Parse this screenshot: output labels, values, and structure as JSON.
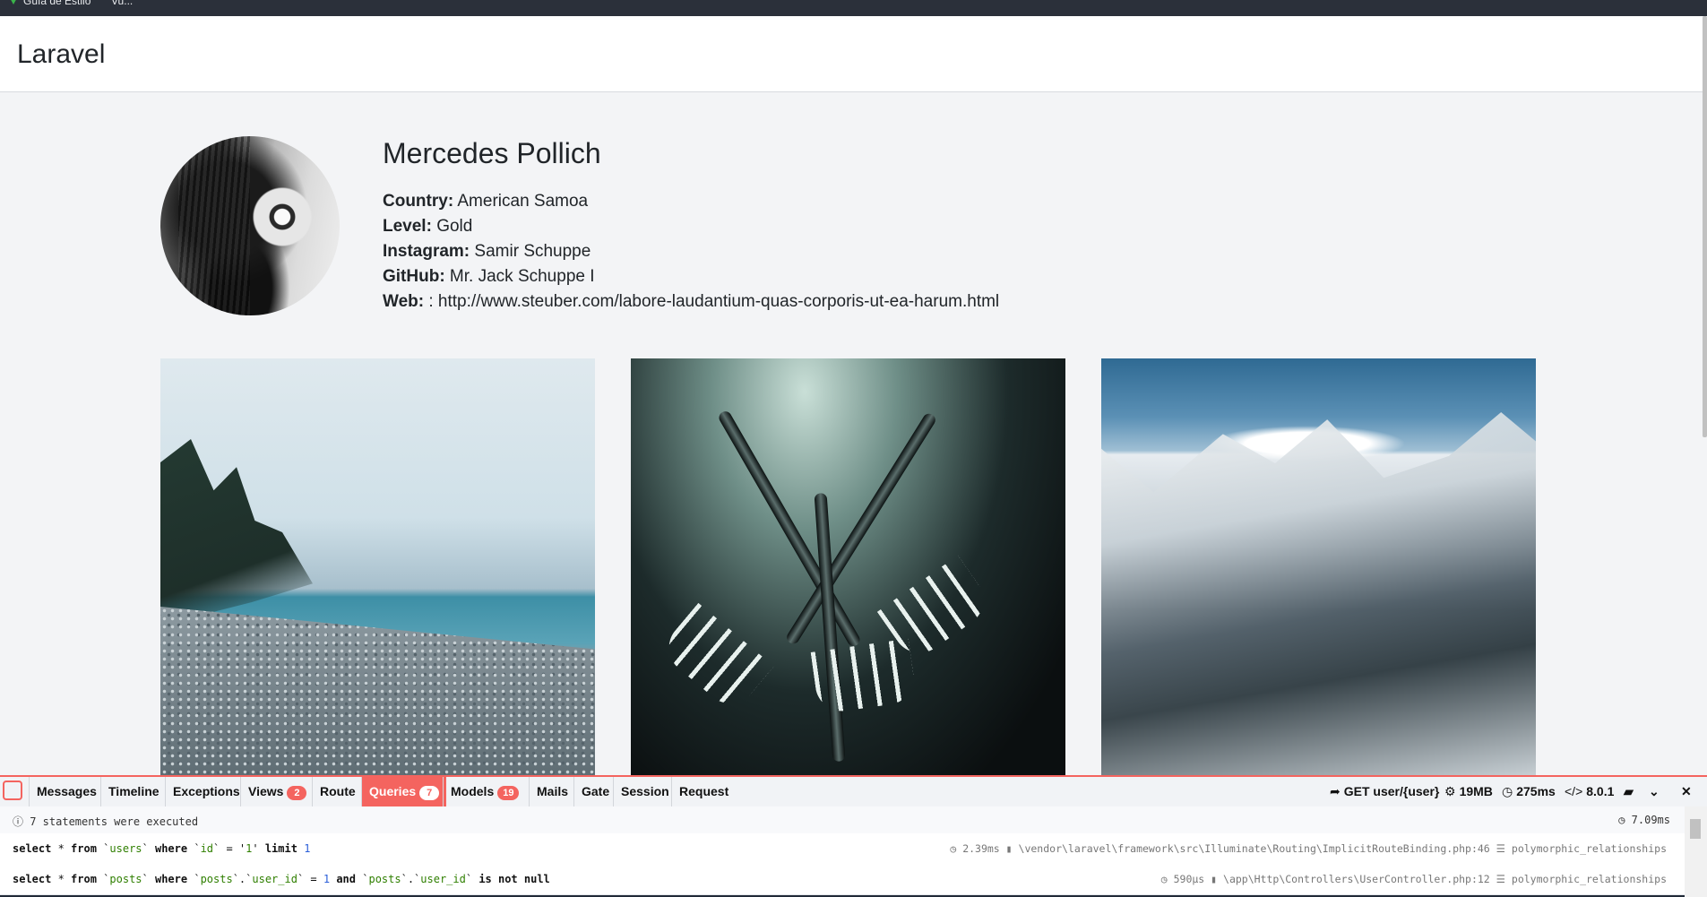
{
  "bookmarks": [
    {
      "label": "Guía de Estilo"
    },
    {
      "label": "Vu..."
    }
  ],
  "navbar": {
    "brand": "Laravel"
  },
  "profile": {
    "name": "Mercedes Pollich",
    "details": [
      {
        "label": "Country:",
        "value": " American Samoa"
      },
      {
        "label": "Level:",
        "value": " Gold"
      },
      {
        "label": "Instagram:",
        "value": " Samir Schuppe"
      },
      {
        "label": "GitHub:",
        "value": " Mr. Jack Schuppe I"
      },
      {
        "label": "Web:",
        "value": " : http://www.steuber.com/labore-laudantium-quas-corporis-ut-ea-harum.html"
      }
    ]
  },
  "photos": [
    "beach",
    "forks",
    "mountains"
  ],
  "debugbar": {
    "tabs": [
      {
        "label": "Messages"
      },
      {
        "label": "Timeline"
      },
      {
        "label": "Exceptions"
      },
      {
        "label": "Views",
        "badge": "2"
      },
      {
        "label": "Route"
      },
      {
        "label": "Queries",
        "badge": "7",
        "active": true
      },
      {
        "label": "Models",
        "badge": "19"
      },
      {
        "label": "Mails"
      },
      {
        "label": "Gate"
      },
      {
        "label": "Session"
      },
      {
        "label": "Request"
      }
    ],
    "right": {
      "request": "GET user/{user}",
      "memory": "19MB",
      "duration": "275ms",
      "php": "8.0.1"
    },
    "status": {
      "text": "7 statements were executed",
      "time": "7.09ms"
    },
    "queries": [
      {
        "sql": "select * from `users` where `id` = '1' limit 1",
        "duration": "2.39ms",
        "source": "\\vendor\\laravel\\framework\\src\\Illuminate\\Routing\\ImplicitRouteBinding.php:46",
        "connection": "polymorphic_relationships"
      },
      {
        "sql": "select * from `posts` where `posts`.`user_id` = 1 and `posts`.`user_id` is not null",
        "duration": "590μs",
        "source": "\\app\\Http\\Controllers\\UserController.php:12",
        "connection": "polymorphic_relationships"
      }
    ]
  },
  "colors": {
    "accent": "#f4645f",
    "debugbar_bg": "#212a38",
    "page_bg": "#f3f4f6"
  }
}
